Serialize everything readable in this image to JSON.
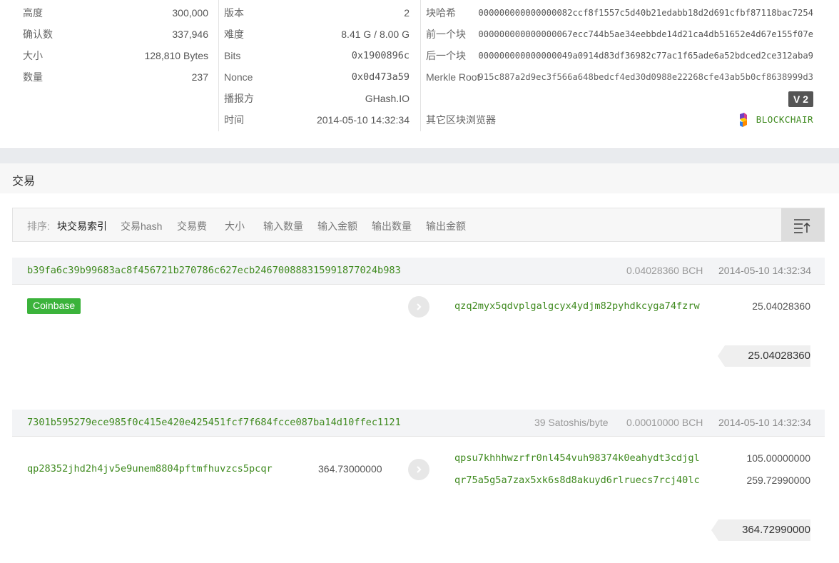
{
  "summary": {
    "col1": [
      {
        "label": "高度",
        "value": "300,000"
      },
      {
        "label": "确认数",
        "value": "337,946"
      },
      {
        "label": "大小",
        "value": "128,810 Bytes"
      },
      {
        "label": "数量",
        "value": "237"
      }
    ],
    "col2": [
      {
        "label": "版本",
        "value": "2"
      },
      {
        "label": "难度",
        "value": "8.41 G / 8.00 G"
      },
      {
        "label": "Bits",
        "value": "0x1900896c"
      },
      {
        "label": "Nonce",
        "value": "0x0d473a59"
      },
      {
        "label": "播报方",
        "value": "GHash.IO"
      },
      {
        "label": "时间",
        "value": "2014-05-10 14:32:34"
      }
    ],
    "col3": [
      {
        "label": "块哈希",
        "value": "000000000000000082ccf8f1557c5d40b21edabb18d2d691cfbf87118bac7254"
      },
      {
        "label": "前一个块",
        "value": "000000000000000067ecc744b5ae34eebbde14d21ca4db51652e4d67e155f07e"
      },
      {
        "label": "后一个块",
        "value": "000000000000000049a0914d83df36982c77ac1f65ade6a52bdced2ce312aba9"
      },
      {
        "label": "Merkle Root",
        "value": "915c887a2d9ec3f566a648bedcf4ed30d0988e22268cfe43ab5b0cf8638999d3"
      }
    ],
    "version_badge": "V 2",
    "explorers_label": "其它区块浏览器",
    "explorer_name": "BLOCKCHAIR"
  },
  "transactions_title": "交易",
  "sortbar": {
    "label": "排序:",
    "items": [
      "块交易索引",
      "交易hash",
      "交易费",
      "大小",
      "输入数量",
      "输入金额",
      "输出数量",
      "输出金额"
    ]
  },
  "txs": [
    {
      "hash": "b39fa6c39b99683ac8f456721b270786c627ecb246700888315991877024b983",
      "fee_rate": "",
      "fee": "0.04028360 BCH",
      "time": "2014-05-10 14:32:34",
      "input_label": "Coinbase",
      "outputs": [
        {
          "address": "qzq2myx5qdvplgalgcyx4ydjm82pyhdkcyga74fzrw",
          "amount": "25.04028360"
        }
      ],
      "total": "25.04028360"
    },
    {
      "hash": "7301b595279ece985f0c415e420e425451fcf7f684fcce087ba14d10ffec1121",
      "fee_rate": "39 Satoshis/byte",
      "fee": "0.00010000 BCH",
      "time": "2014-05-10 14:32:34",
      "inputs": [
        {
          "address": "qp28352jhd2h4jv5e9unem8804pftmfhuvzcs5pcqr",
          "amount": "364.73000000"
        }
      ],
      "outputs": [
        {
          "address": "qpsu7khhhwzrfr0nl454vuh98374k0eahydt3cdjgl",
          "amount": "105.00000000"
        },
        {
          "address": "qr75a5g5a7zax5xk6s8d8akuyd6rlruecs7rcj40lc",
          "amount": "259.72990000"
        }
      ],
      "total": "364.72990000"
    }
  ],
  "colors": {
    "accent_green": "#3f8a1f",
    "coinbase_badge": "#3bb33b"
  }
}
